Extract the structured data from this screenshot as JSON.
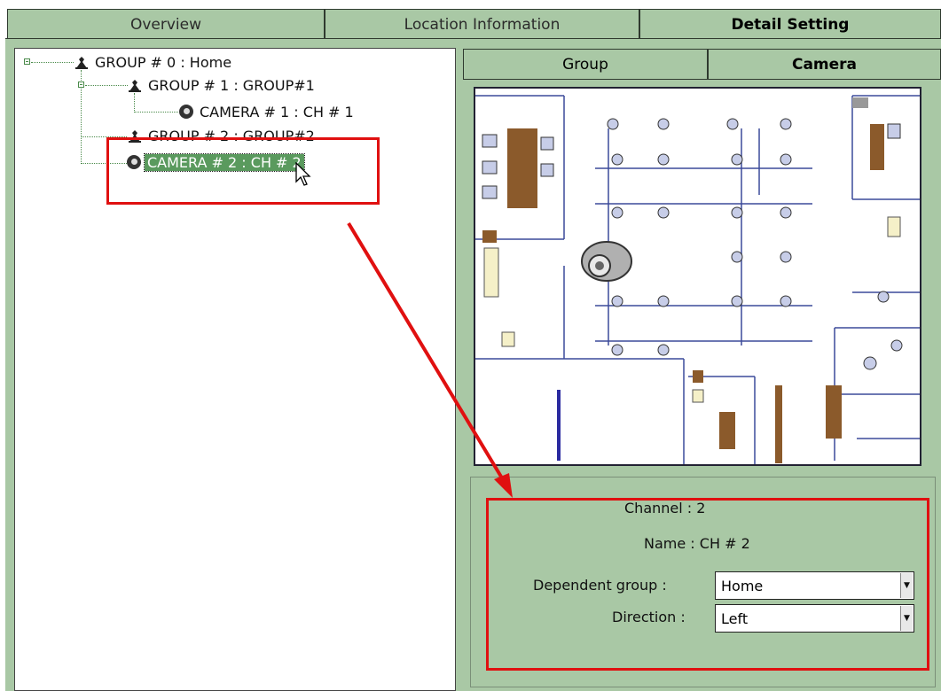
{
  "tabs": [
    {
      "label": "Overview",
      "active": false
    },
    {
      "label": "Location Information",
      "active": false
    },
    {
      "label": "Detail Setting",
      "active": true
    }
  ],
  "tree": {
    "items": [
      {
        "label": "GROUP # 0 : Home",
        "type": "group",
        "icon": "group-icon"
      },
      {
        "label": "GROUP # 1 : GROUP#1",
        "type": "group",
        "icon": "group-icon"
      },
      {
        "label": "CAMERA # 1 : CH # 1",
        "type": "camera",
        "icon": "camera-icon"
      },
      {
        "label": "GROUP # 2 : GROUP#2",
        "type": "group",
        "icon": "group-icon"
      },
      {
        "label": "CAMERA # 2 : CH # 2",
        "type": "camera",
        "icon": "camera-icon",
        "selected": true
      }
    ]
  },
  "subtabs": [
    {
      "label": "Group",
      "active": false
    },
    {
      "label": "Camera",
      "active": true
    }
  ],
  "details": {
    "channel_label": "Channel :",
    "channel_value": "2",
    "name_label": "Name :",
    "name_value": "CH # 2",
    "dependent_group_label": "Dependent group :",
    "dependent_group_value": "Home",
    "direction_label": "Direction :",
    "direction_value": "Left"
  },
  "colors": {
    "panel_bg": "#a9c8a5",
    "selected_bg": "#5a9a5e",
    "annotation": "#e01010"
  }
}
